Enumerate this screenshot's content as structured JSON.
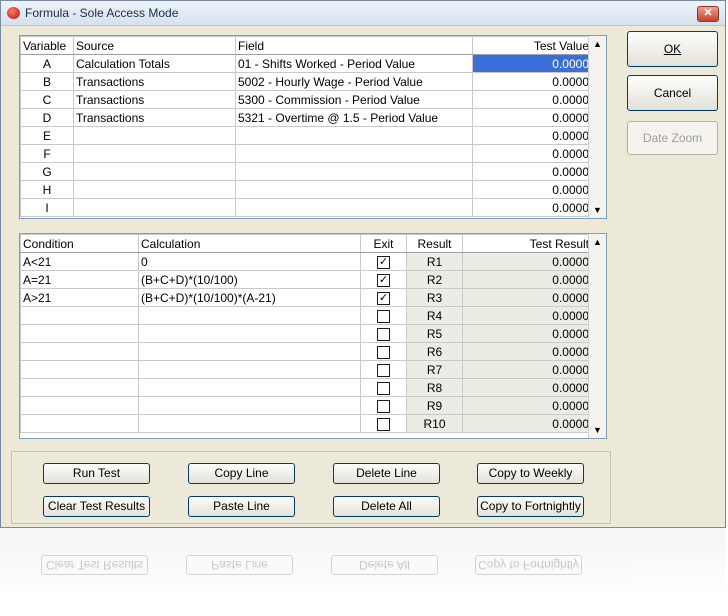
{
  "window": {
    "title": "Formula - Sole Access Mode",
    "close_glyph": "✕"
  },
  "variables": {
    "headers": {
      "variable": "Variable",
      "source": "Source",
      "field": "Field",
      "test_value": "Test Value"
    },
    "rows": [
      {
        "variable": "A",
        "source": "Calculation Totals",
        "field": "01 - Shifts Worked - Period Value",
        "test_value": "0.0000"
      },
      {
        "variable": "B",
        "source": "Transactions",
        "field": "5002 - Hourly Wage - Period Value",
        "test_value": "0.0000"
      },
      {
        "variable": "C",
        "source": "Transactions",
        "field": "5300 - Commission - Period Value",
        "test_value": "0.0000"
      },
      {
        "variable": "D",
        "source": "Transactions",
        "field": "5321 - Overtime @ 1.5 - Period Value",
        "test_value": "0.0000"
      },
      {
        "variable": "E",
        "source": "",
        "field": "",
        "test_value": "0.0000"
      },
      {
        "variable": "F",
        "source": "",
        "field": "",
        "test_value": "0.0000"
      },
      {
        "variable": "G",
        "source": "",
        "field": "",
        "test_value": "0.0000"
      },
      {
        "variable": "H",
        "source": "",
        "field": "",
        "test_value": "0.0000"
      },
      {
        "variable": "I",
        "source": "",
        "field": "",
        "test_value": "0.0000"
      }
    ]
  },
  "conditions": {
    "headers": {
      "condition": "Condition",
      "calculation": "Calculation",
      "exit": "Exit",
      "result": "Result",
      "test_result": "Test Result"
    },
    "rows": [
      {
        "condition": "A<21",
        "calculation": "0",
        "exit": true,
        "result": "R1",
        "test_result": "0.0000"
      },
      {
        "condition": "A=21",
        "calculation": "(B+C+D)*(10/100)",
        "exit": true,
        "result": "R2",
        "test_result": "0.0000"
      },
      {
        "condition": "A>21",
        "calculation": "(B+C+D)*(10/100)*(A-21)",
        "exit": true,
        "result": "R3",
        "test_result": "0.0000"
      },
      {
        "condition": "",
        "calculation": "",
        "exit": false,
        "result": "R4",
        "test_result": "0.0000"
      },
      {
        "condition": "",
        "calculation": "",
        "exit": false,
        "result": "R5",
        "test_result": "0.0000"
      },
      {
        "condition": "",
        "calculation": "",
        "exit": false,
        "result": "R6",
        "test_result": "0.0000"
      },
      {
        "condition": "",
        "calculation": "",
        "exit": false,
        "result": "R7",
        "test_result": "0.0000"
      },
      {
        "condition": "",
        "calculation": "",
        "exit": false,
        "result": "R8",
        "test_result": "0.0000"
      },
      {
        "condition": "",
        "calculation": "",
        "exit": false,
        "result": "R9",
        "test_result": "0.0000"
      },
      {
        "condition": "",
        "calculation": "",
        "exit": false,
        "result": "R10",
        "test_result": "0.0000"
      }
    ]
  },
  "side_buttons": {
    "ok": "OK",
    "cancel": "Cancel",
    "date_zoom": "Date Zoom"
  },
  "actions": {
    "run_test": "Run Test",
    "copy_line": "Copy Line",
    "delete_line": "Delete Line",
    "copy_to_weekly": "Copy to Weekly",
    "clear_test_results": "Clear Test Results",
    "paste_line": "Paste Line",
    "delete_all": "Delete All",
    "copy_to_fortnightly": "Copy to Fortnightly"
  },
  "icons": {
    "checkmark": "✓",
    "scroll_up": "▲",
    "scroll_down": "▼"
  },
  "colors": {
    "selection": "#3b6ed6",
    "button_border": "#003c74"
  }
}
